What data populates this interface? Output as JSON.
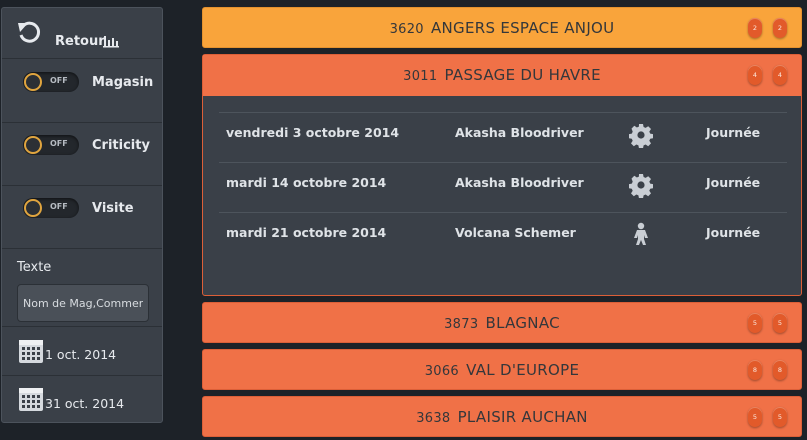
{
  "sidebar": {
    "back_label": "Retour",
    "toggles": [
      {
        "label": "Magasin",
        "state": "OFF"
      },
      {
        "label": "Criticity",
        "state": "OFF"
      },
      {
        "label": "Visite",
        "state": "OFF"
      }
    ],
    "text_filter": {
      "label": "Texte",
      "placeholder": "Nom de Mag,Commercial"
    },
    "dates": [
      {
        "value": "1 oct. 2014",
        "icon": "calendar-icon"
      },
      {
        "value": "31 oct. 2014",
        "icon": "calendar-icon"
      }
    ]
  },
  "stores": [
    {
      "number": "3620",
      "name": "ANGERS ESPACE ANJOU",
      "badges": [
        "2",
        "2"
      ],
      "color": "#f9a43b"
    },
    {
      "number": "3011",
      "name": "PASSAGE DU HAVRE",
      "badges": [
        "4",
        "4"
      ],
      "color": "#f07147",
      "visits": [
        {
          "date": "vendredi 3 octobre 2014",
          "person": "Akasha Bloodriver",
          "icon": "gear-icon",
          "period": "Journée"
        },
        {
          "date": "mardi 14 octobre 2014",
          "person": "Akasha Bloodriver",
          "icon": "gear-icon",
          "period": "Journée"
        },
        {
          "date": "mardi 21 octobre 2014",
          "person": "Volcana Schemer",
          "icon": "person-icon",
          "period": "Journée"
        }
      ]
    },
    {
      "number": "3873",
      "name": "BLAGNAC",
      "badges": [
        "5",
        "5"
      ],
      "color": "#f07147"
    },
    {
      "number": "3066",
      "name": "VAL D'EUROPE",
      "badges": [
        "8",
        "8"
      ],
      "color": "#f07147"
    },
    {
      "number": "3638",
      "name": "PLAISIR AUCHAN",
      "badges": [
        "5",
        "5"
      ],
      "color": "#f07147"
    }
  ]
}
